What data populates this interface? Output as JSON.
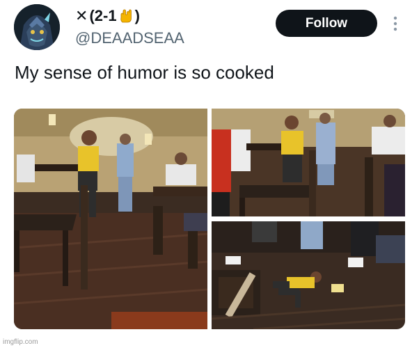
{
  "author": {
    "name_prefix": "✕",
    "name_text": "(2-1",
    "name_suffix": ")",
    "handle": "@DEAADSEAA"
  },
  "follow_label": "Follow",
  "post": {
    "text": "My sense of humor is so cooked"
  },
  "media": {
    "photos": [
      {
        "name": "photo-left",
        "desc_icon": "restaurant-toddler-standing"
      },
      {
        "name": "photo-top-right",
        "desc_icon": "restaurant-toddler-chair"
      },
      {
        "name": "photo-bottom-right",
        "desc_icon": "restaurant-toddler-floor"
      }
    ]
  },
  "watermark": "imgflip.com",
  "colors": {
    "text": "#0f1419",
    "secondary": "#536471",
    "button_bg": "#0f1419",
    "button_text": "#ffffff"
  }
}
